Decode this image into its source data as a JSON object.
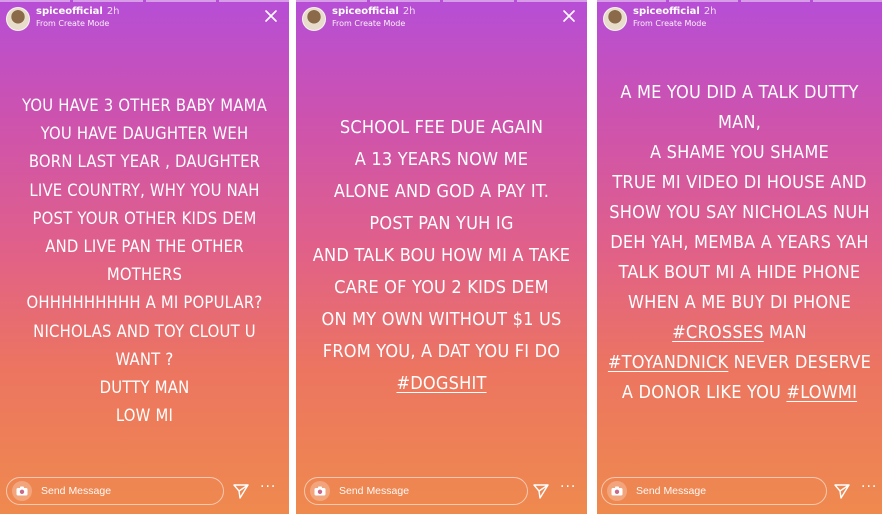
{
  "stories": [
    {
      "username": "spiceofficial",
      "time": "2h",
      "subtitle": "From Create Mode",
      "lines": [
        "YOU HAVE 3 OTHER BABY MAMA",
        "YOU HAVE DAUGHTER WEH",
        "BORN LAST YEAR , DAUGHTER",
        "LIVE COUNTRY, WHY YOU NAH",
        "POST YOUR OTHER KIDS DEM",
        "AND LIVE PAN THE OTHER",
        "MOTHERS",
        "OHHHHHHHHH A MI POPULAR?",
        "NICHOLAS AND TOY CLOUT U",
        "WANT ?",
        "DUTTY MAN",
        "LOW MI"
      ],
      "send_placeholder": "Send Message"
    },
    {
      "username": "spiceofficial",
      "time": "2h",
      "subtitle": "From Create Mode",
      "lines": [
        "SCHOOL FEE DUE AGAIN",
        "A 13 YEARS NOW ME",
        "ALONE AND GOD A PAY IT.",
        "POST PAN YUH IG",
        "AND TALK BOU HOW MI A TAKE",
        "CARE OF YOU 2 KIDS DEM",
        "ON MY OWN WITHOUT $1 US",
        "FROM YOU, A DAT YOU FI DO"
      ],
      "hashtag": "#DOGSHIT",
      "send_placeholder": "Send Message"
    },
    {
      "username": "spiceofficial",
      "time": "2h",
      "subtitle": "From Create Mode",
      "lines": [
        "A ME YOU DID A TALK DUTTY",
        "MAN,",
        "A SHAME YOU SHAME",
        "TRUE MI VIDEO DI HOUSE AND",
        "SHOW YOU SAY NICHOLAS NUH",
        "DEH YAH, MEMBA A YEARS YAH",
        "TALK BOUT MI A HIDE PHONE",
        "WHEN A ME BUY DI PHONE"
      ],
      "line9": {
        "tag": "#CROSSES",
        "text": " MAN"
      },
      "line10": {
        "tag": "#TOYANDNICK",
        "text": " NEVER DESERVE"
      },
      "line11": {
        "text": "A DONOR LIKE YOU ",
        "tag": "#LOWMI"
      },
      "send_placeholder": "Send Message"
    }
  ],
  "more_label": "···"
}
